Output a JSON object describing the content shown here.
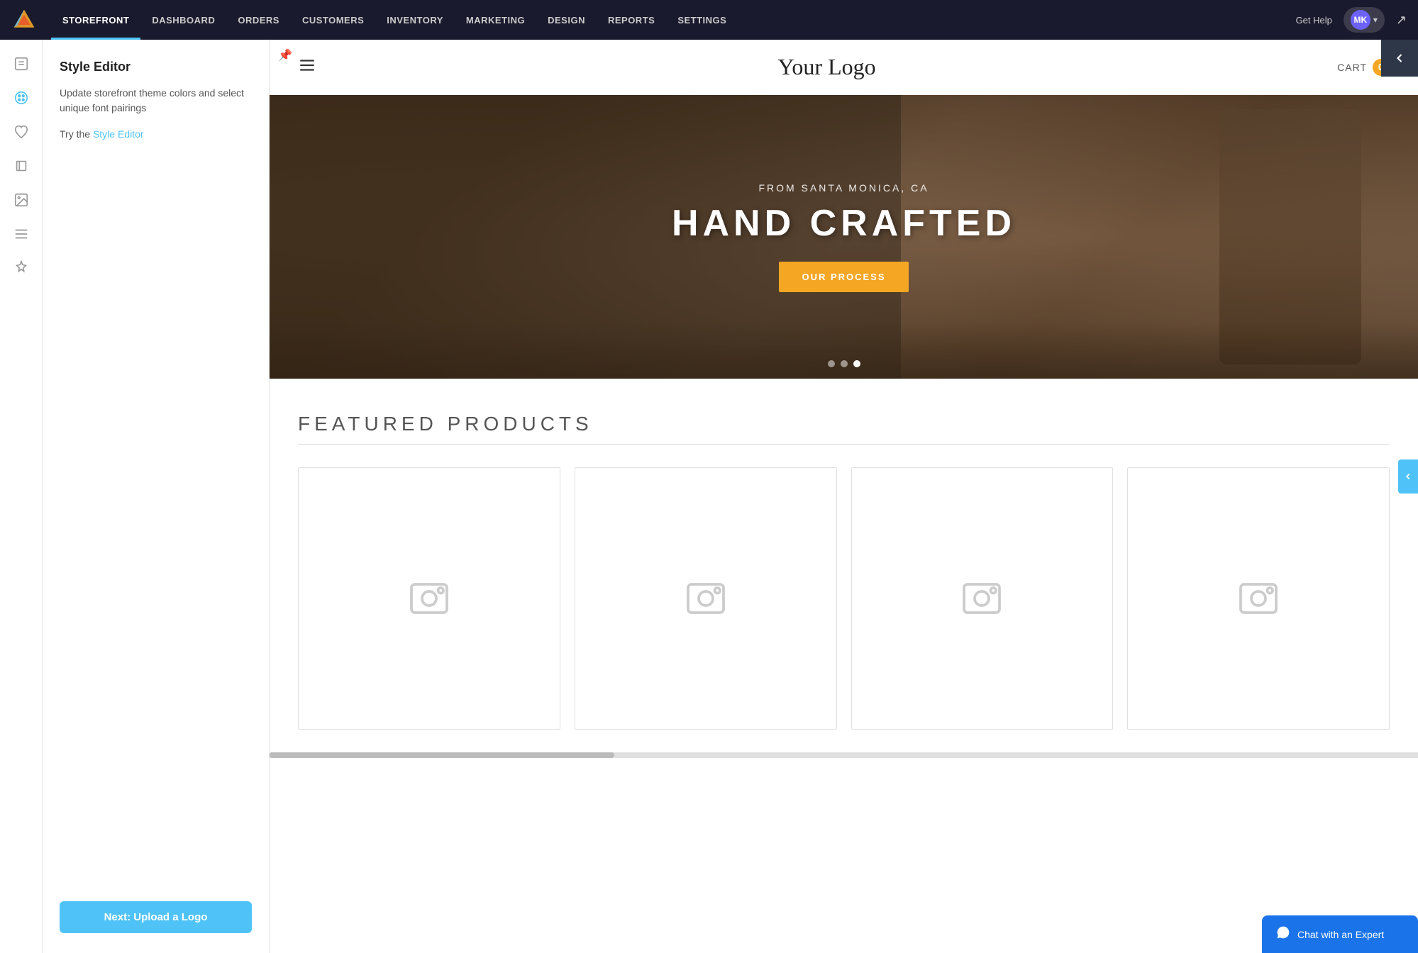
{
  "nav": {
    "items": [
      {
        "id": "storefront",
        "label": "STOREFRONT",
        "active": true
      },
      {
        "id": "dashboard",
        "label": "DASHBOARD",
        "active": false
      },
      {
        "id": "orders",
        "label": "ORDERS",
        "active": false
      },
      {
        "id": "customers",
        "label": "CUSTOMERS",
        "active": false
      },
      {
        "id": "inventory",
        "label": "INVENTORY",
        "active": false
      },
      {
        "id": "marketing",
        "label": "MARKETING",
        "active": false
      },
      {
        "id": "design",
        "label": "DESIGN",
        "active": false
      },
      {
        "id": "reports",
        "label": "REPORTS",
        "active": false
      },
      {
        "id": "settings",
        "label": "SETTINGS",
        "active": false
      }
    ],
    "get_help": "Get Help",
    "user_initials": "MK",
    "external_icon": "⬡"
  },
  "sidebar": {
    "icons": [
      {
        "id": "pages",
        "symbol": "📄",
        "active": false
      },
      {
        "id": "palette",
        "symbol": "🎨",
        "active": true
      },
      {
        "id": "heart",
        "symbol": "♡",
        "active": false
      },
      {
        "id": "tshirt",
        "symbol": "👕",
        "active": false
      },
      {
        "id": "image",
        "symbol": "🖼",
        "active": false
      },
      {
        "id": "list",
        "symbol": "☰",
        "active": false
      },
      {
        "id": "magic",
        "symbol": "✨",
        "active": false
      }
    ]
  },
  "style_editor": {
    "title": "Style Editor",
    "description": "Update storefront theme colors and select unique font pairings",
    "try_text": "Try the",
    "link_text": "Style Editor",
    "next_button": "Next: Upload a Logo"
  },
  "preview": {
    "logo": "Your Logo",
    "cart_label": "CART",
    "cart_count": "0",
    "hero": {
      "subtitle": "FROM SANTA MONICA, CA",
      "title": "HAND CRAFTED",
      "cta": "OUR PROCESS",
      "dots": [
        {
          "active": false
        },
        {
          "active": false
        },
        {
          "active": true
        }
      ]
    },
    "featured": {
      "title": "FEATURED PRODUCTS",
      "products": [
        {
          "id": 1
        },
        {
          "id": 2
        },
        {
          "id": 3
        },
        {
          "id": 4
        }
      ]
    }
  },
  "chat": {
    "label": "Chat with an Expert",
    "icon": "💬"
  }
}
